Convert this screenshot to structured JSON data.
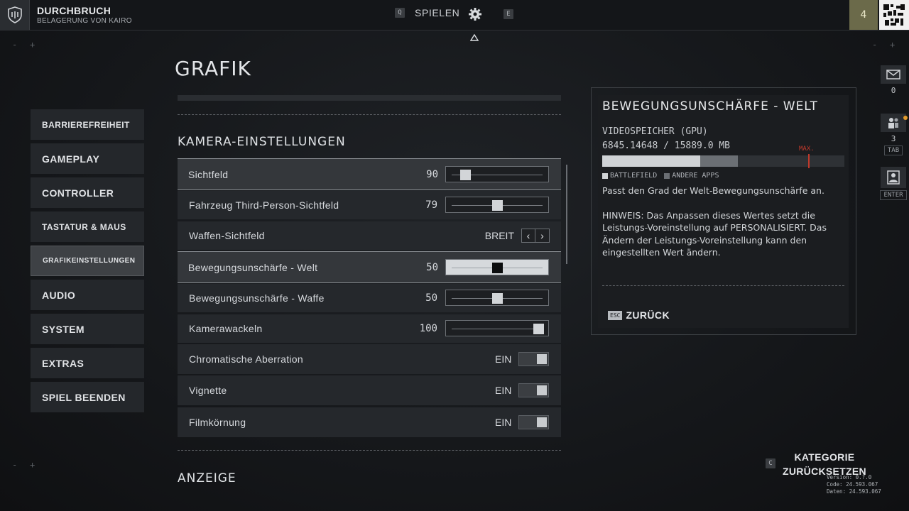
{
  "header": {
    "mode_title": "DURCHBRUCH",
    "mode_subtitle": "BELAGERUNG VON KAIRO",
    "nav_left_key": "Q",
    "play_label": "SPIELEN",
    "nav_right_key": "E",
    "player_level": "4"
  },
  "page_title": "GRAFIK",
  "menu": {
    "items": [
      {
        "label": "BARRIEREFREIHEIT"
      },
      {
        "label": "GAMEPLAY"
      },
      {
        "label": "CONTROLLER"
      },
      {
        "label": "TASTATUR & MAUS"
      },
      {
        "label": "GRAFIKEINSTELLUNGEN"
      },
      {
        "label": "AUDIO"
      },
      {
        "label": "SYSTEM"
      },
      {
        "label": "EXTRAS"
      },
      {
        "label": "SPIEL BEENDEN"
      }
    ],
    "active_index": 4
  },
  "section_camera": "KAMERA-EINSTELLUNGEN",
  "section_display": "ANZEIGE",
  "settings": [
    {
      "label": "Sichtfeld",
      "value": "90",
      "slider_fraction": 0.12
    },
    {
      "label": "Fahrzeug Third-Person-Sichtfeld",
      "value": "79",
      "slider_fraction": 0.5
    },
    {
      "label": "Waffen-Sichtfeld",
      "choice": "BREIT"
    },
    {
      "label": "Bewegungsunschärfe - Welt",
      "value": "50",
      "slider_fraction": 0.5
    },
    {
      "label": "Bewegungsunschärfe - Waffe",
      "value": "50",
      "slider_fraction": 0.5
    },
    {
      "label": "Kamerawackeln",
      "value": "100",
      "slider_fraction": 1.0
    },
    {
      "label": "Chromatische Aberration",
      "toggle": "EIN"
    },
    {
      "label": "Vignette",
      "toggle": "EIN"
    },
    {
      "label": "Filmkörnung",
      "toggle": "EIN"
    }
  ],
  "detail": {
    "title": "BEWEGUNGSUNSCHÄRFE - WELT",
    "memory_label": "VIDEOSPEICHER (GPU)",
    "memory_value": "6845.14648 / 15889.0 MB",
    "battlefield_fraction": 0.405,
    "other_apps_fraction": 0.155,
    "max_fraction": 0.85,
    "max_label": "MAX.",
    "legend_battlefield": "BATTLEFIELD",
    "legend_other": "ANDERE APPS",
    "description": "Passt den Grad der Welt-Bewegungsunschärfe an.",
    "note": "HINWEIS: Das Anpassen dieses Wertes setzt die Leistungs-Voreinstellung auf PERSONALISIERT. Das Ändern der Leistungs-Voreinstellung kann den eingestellten Wert ändern.",
    "back_key": "ESC",
    "back_label": "ZURÜCK"
  },
  "side": {
    "mail_count": "0",
    "squad_count": "3",
    "squad_key": "TAB",
    "profile_key": "ENTER"
  },
  "reset": {
    "key": "C",
    "line1": "KATEGORIE",
    "line2": "ZURÜCKSETZEN"
  },
  "version": {
    "version": "Version: 0.?.0",
    "code": "Code: 24.593.067",
    "data": "Daten: 24.593.067"
  },
  "colors": {
    "accent_level": "#6b6a4a",
    "max_marker": "#c0392b",
    "notification_dot": "#e39a2a"
  }
}
